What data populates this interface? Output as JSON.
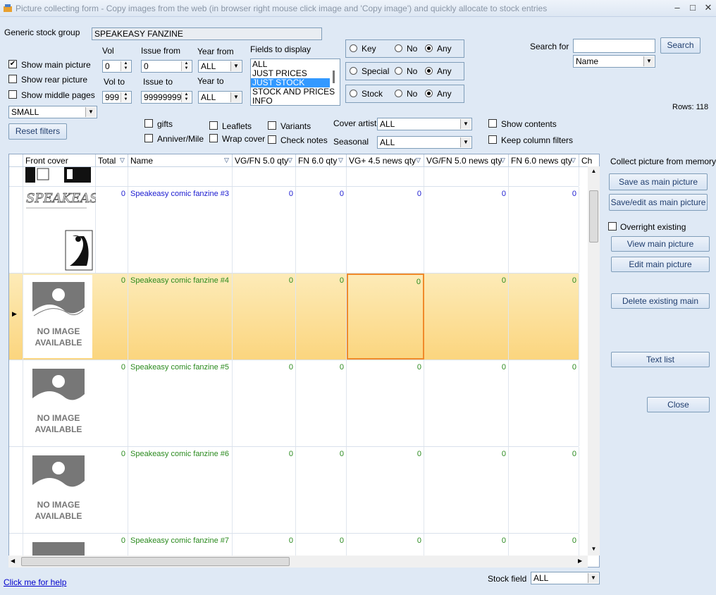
{
  "window": {
    "title": "Picture collecting form - Copy images from the web (in browser right mouse click image and 'Copy image') and quickly allocate to stock entries",
    "min": "–",
    "max": "□",
    "close": "✕"
  },
  "filters": {
    "generic_stock_group_label": "Generic stock group",
    "generic_stock_group_value": "SPEAKEASY FANZINE",
    "show_main_picture": "Show main picture",
    "show_rear_picture": "Show rear picture",
    "show_middle_pages": "Show middle pages",
    "size_value": "SMALL",
    "reset_filters": "Reset filters",
    "vol_label": "Vol",
    "vol_value": "0",
    "vol_to_label": "Vol to",
    "vol_to_value": "999",
    "issue_from_label": "Issue from",
    "issue_from_value": "0",
    "issue_to_label": "Issue to",
    "issue_to_value": "99999999",
    "year_from_label": "Year from",
    "year_from_value": "ALL",
    "year_to_label": "Year to",
    "year_to_value": "ALL",
    "fields_to_display_label": "Fields to display",
    "fields_to_display": [
      "ALL",
      "JUST PRICES",
      "JUST STOCK",
      "STOCK AND PRICES",
      "INFO"
    ],
    "fields_selected": "JUST STOCK",
    "key_label": "Key",
    "special_label": "Special",
    "stock_label": "Stock",
    "no_label": "No",
    "any_label": "Any",
    "gifts": "gifts",
    "anniver": "Anniver/Mile",
    "leaflets": "Leaflets",
    "wrap_cover": "Wrap cover",
    "variants": "Variants",
    "check_notes": "Check notes",
    "cover_artist_label": "Cover artist",
    "cover_artist_value": "ALL",
    "seasonal_label": "Seasonal",
    "seasonal_value": "ALL",
    "show_contents": "Show contents",
    "keep_column_filters": "Keep column filters",
    "search_for_label": "Search for",
    "search_value": "",
    "search_button": "Search",
    "search_field_value": "Name",
    "rows_label": "Rows: 118"
  },
  "grid": {
    "columns": [
      "Front cover",
      "Total",
      "Name",
      "VG/FN 5.0 qty",
      "FN 6.0 qty",
      "VG+ 4.5 news qty",
      "VG/FN 5.0 news qty",
      "FN 6.0 news qty",
      "Ch"
    ],
    "rows": [
      {
        "name": "Speakeasy comic fanzine #3",
        "total": "0",
        "q1": "0",
        "q2": "0",
        "q3": "0",
        "q4": "0",
        "q5": "0",
        "has_image": true,
        "selected": false,
        "name_color": "#1a1ad0"
      },
      {
        "name": "Speakeasy comic fanzine #4",
        "total": "0",
        "q1": "0",
        "q2": "0",
        "q3": "0",
        "q4": "0",
        "q5": "0",
        "has_image": false,
        "selected": true,
        "name_color": "#2a8a1e"
      },
      {
        "name": "Speakeasy comic fanzine #5",
        "total": "0",
        "q1": "0",
        "q2": "0",
        "q3": "0",
        "q4": "0",
        "q5": "0",
        "has_image": false,
        "selected": false,
        "name_color": "#2a8a1e"
      },
      {
        "name": "Speakeasy comic fanzine #6",
        "total": "0",
        "q1": "0",
        "q2": "0",
        "q3": "0",
        "q4": "0",
        "q5": "0",
        "has_image": false,
        "selected": false,
        "name_color": "#2a8a1e"
      },
      {
        "name": "Speakeasy comic fanzine #7",
        "total": "0",
        "q1": "0",
        "q2": "0",
        "q3": "0",
        "q4": "0",
        "q5": "0",
        "has_image": false,
        "selected": false,
        "name_color": "#2a8a1e"
      }
    ],
    "no_image_line1": "NO IMAGE",
    "no_image_line2": "AVAILABLE",
    "cover_logo_text": "SPEAKEASY"
  },
  "side_panel": {
    "collect_label": "Collect picture from memory",
    "save_as_main": "Save as main picture",
    "save_edit_main": "Save/edit as main picture",
    "overright_existing": "Overright existing",
    "view_main": "View main picture",
    "edit_main": "Edit main picture",
    "delete_existing_main": "Delete existing main",
    "text_list": "Text list",
    "close": "Close"
  },
  "footer": {
    "help_link": "Click me for help",
    "stock_field_label": "Stock field",
    "stock_field_value": "ALL"
  },
  "colors": {
    "selected_row": "#fddb8c",
    "selected_cell_border": "#f08a2a",
    "background": "#dfe9f5"
  }
}
